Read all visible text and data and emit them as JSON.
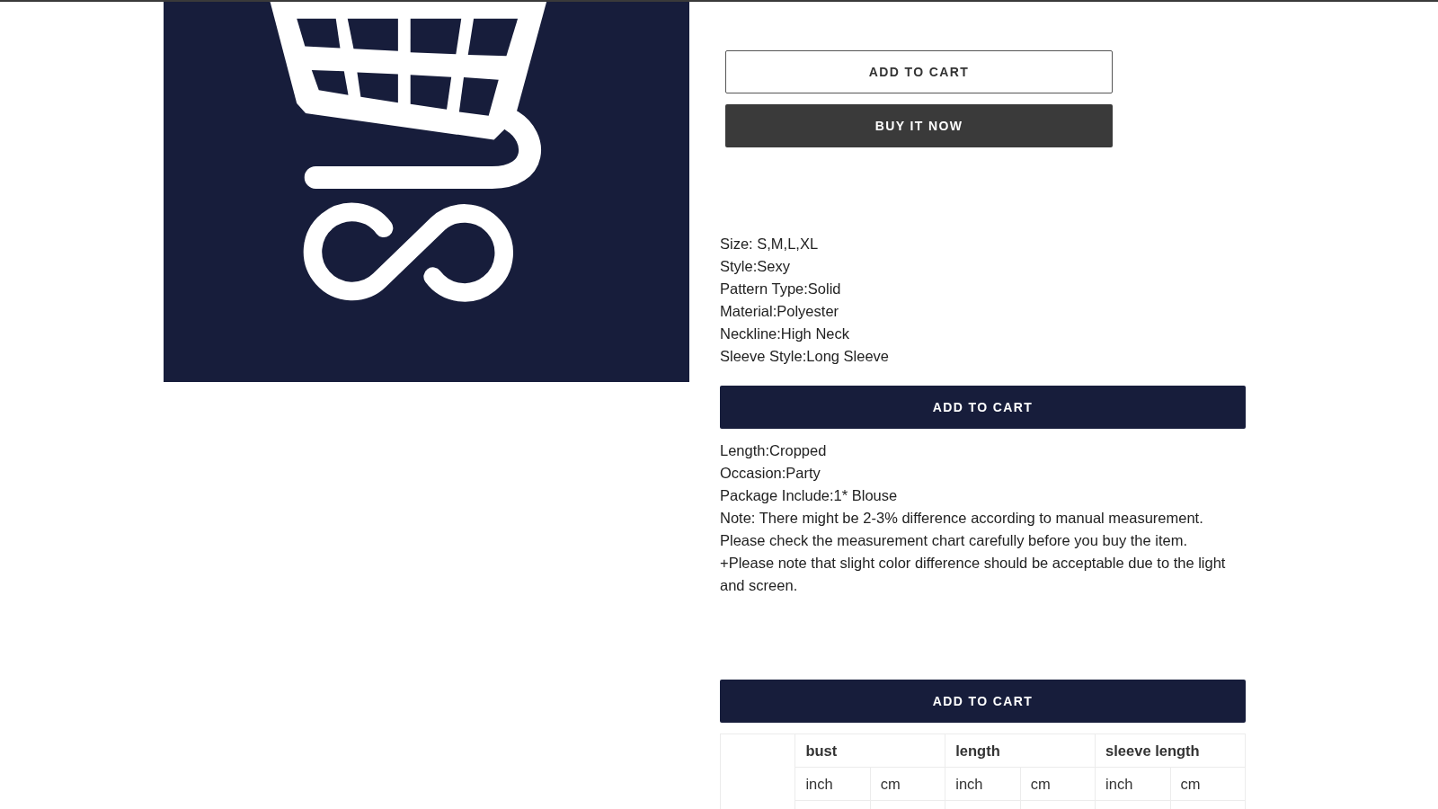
{
  "top_buttons": [
    {
      "label": "ADD TO CART",
      "kind": "outline"
    },
    {
      "label": "BUY IT NOW",
      "kind": "dark"
    }
  ],
  "specs": [
    "Size: S,M,L,XL",
    "Style:Sexy",
    "Pattern Type:Solid",
    "Material:Polyester",
    "Neckline:High Neck",
    "Sleeve Style:Long Sleeve"
  ],
  "add_to_cart_button": {
    "label": "ADD TO CART"
  },
  "notes": [
    "Length:Cropped",
    "Occasion:Party",
    "Package Include:1* Blouse",
    "Note: There might be 2-3% difference according to manual measurement.",
    "Please check the measurement chart carefully before you buy the item.",
    "+Please note that slight color difference should be acceptable due to the light and screen."
  ],
  "second_add_to_cart_button": {
    "label": "ADD TO CART"
  },
  "size_table": {
    "headers": [
      "bust",
      "length",
      "sleeve length"
    ],
    "units": [
      "inch",
      "cm",
      "inch",
      "cm",
      "inch",
      "cm"
    ]
  }
}
